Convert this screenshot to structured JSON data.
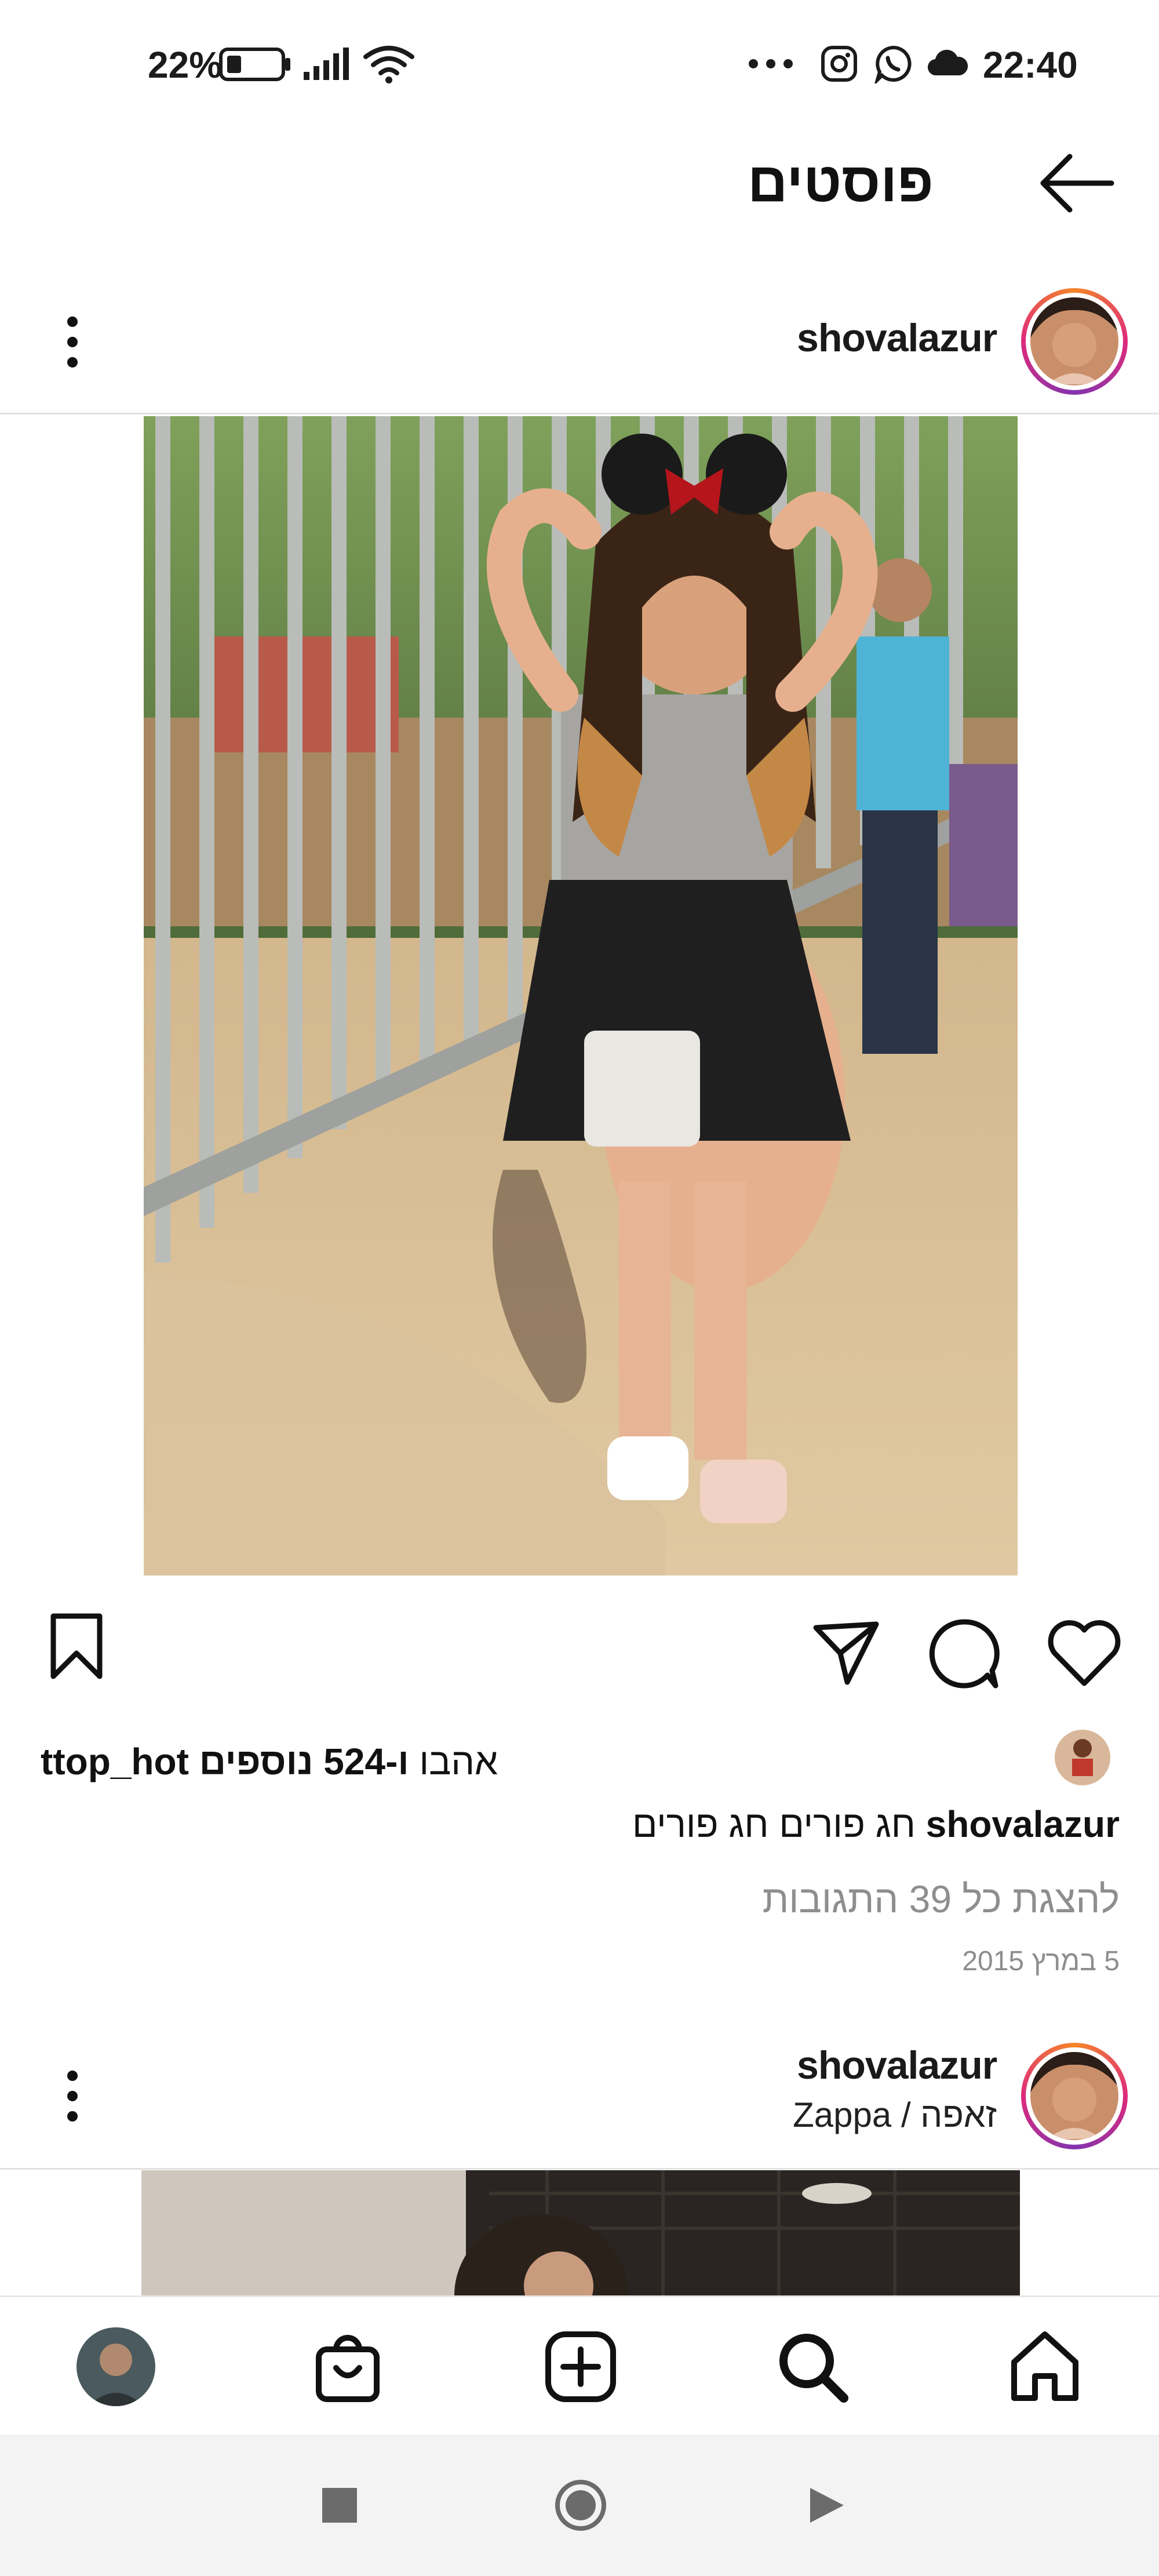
{
  "status_bar": {
    "battery_percent": "22%",
    "time": "22:40",
    "icons": [
      "battery-icon",
      "signal-icon",
      "wifi-icon",
      "more-icon",
      "instagram-icon",
      "whatsapp-icon",
      "cloud-icon"
    ]
  },
  "header": {
    "title": "פוסטים",
    "back_icon": "arrow-left-icon"
  },
  "post1": {
    "username": "shovalazur",
    "likes": {
      "liker": "ttop_hot",
      "loved": "אהבו",
      "others": "ו-524 נוספים"
    },
    "caption": {
      "username": "shovalazur",
      "text": "חג פורים חג פורים"
    },
    "view_comments": "להצגת כל 39 התגובות",
    "date": "5 במרץ 2015"
  },
  "post2": {
    "username": "shovalazur",
    "location": "זאפה / Zappa"
  },
  "bottom_nav": [
    "profile",
    "shop",
    "create",
    "search",
    "home"
  ],
  "colors": {
    "accent_ring": [
      "#f58529",
      "#dd2a7b",
      "#8134af"
    ],
    "secondary_text": "#8e8e8e"
  }
}
